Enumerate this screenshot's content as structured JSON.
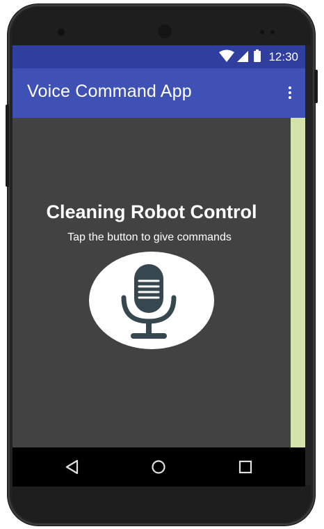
{
  "status_bar": {
    "time": "12:30",
    "icons": [
      "wifi-icon",
      "signal-icon",
      "battery-icon"
    ]
  },
  "app_bar": {
    "title": "Voice Command App",
    "overflow_icon": "more-vert-icon"
  },
  "main": {
    "heading": "Cleaning Robot Control",
    "subheading": "Tap the button to give commands",
    "mic_icon": "microphone-icon"
  },
  "nav_bar": {
    "buttons": [
      "back-icon",
      "home-icon",
      "recents-icon"
    ]
  },
  "colors": {
    "status_bar": "#303f9f",
    "app_bar": "#3f51b5",
    "content_background": "#424242",
    "right_strip": "#d4e3ab",
    "mic_button": "#ffffff",
    "mic_glyph": "#37474f"
  }
}
